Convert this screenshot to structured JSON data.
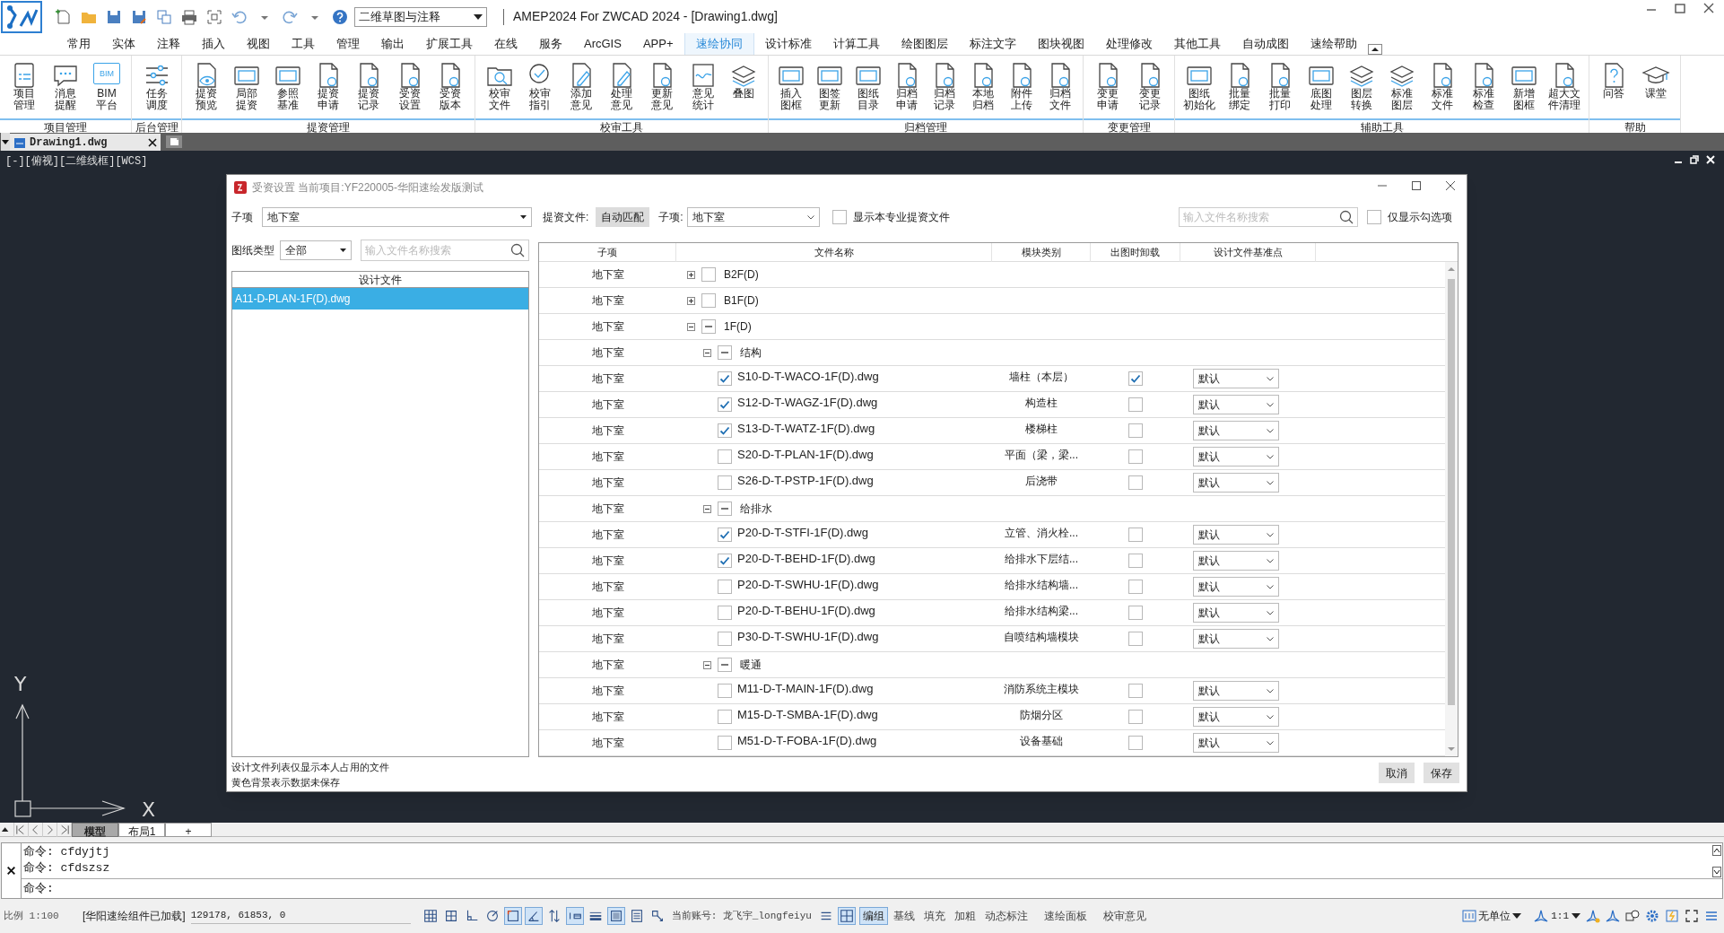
{
  "app": {
    "title": "AMEP2024 For ZWCAD 2024 - [Drawing1.dwg]",
    "workspace": "二维草图与注释"
  },
  "menu_tabs": [
    {
      "label": "常用",
      "selected": false
    },
    {
      "label": "实体",
      "selected": false
    },
    {
      "label": "注释",
      "selected": false
    },
    {
      "label": "插入",
      "selected": false
    },
    {
      "label": "视图",
      "selected": false
    },
    {
      "label": "工具",
      "selected": false
    },
    {
      "label": "管理",
      "selected": false
    },
    {
      "label": "输出",
      "selected": false
    },
    {
      "label": "扩展工具",
      "selected": false
    },
    {
      "label": "在线",
      "selected": false
    },
    {
      "label": "服务",
      "selected": false
    },
    {
      "label": "ArcGIS",
      "selected": false
    },
    {
      "label": "APP+",
      "selected": false
    },
    {
      "label": "速绘协同",
      "selected": true
    },
    {
      "label": "设计标准",
      "selected": false
    },
    {
      "label": "计算工具",
      "selected": false
    },
    {
      "label": "绘图图层",
      "selected": false
    },
    {
      "label": "标注文字",
      "selected": false
    },
    {
      "label": "图块视图",
      "selected": false
    },
    {
      "label": "处理修改",
      "selected": false
    },
    {
      "label": "其他工具",
      "selected": false
    },
    {
      "label": "自动成图",
      "selected": false
    },
    {
      "label": "速绘帮助",
      "selected": false
    }
  ],
  "ribbon_groups": [
    {
      "label": "项目管理",
      "buttons": [
        {
          "lines": [
            "项目",
            "管理"
          ]
        },
        {
          "lines": [
            "消息",
            "提醒"
          ]
        },
        {
          "lines": [
            "BIM",
            "平台"
          ],
          "badge": "BIM"
        }
      ]
    },
    {
      "label": "后台管理",
      "buttons": [
        {
          "lines": [
            "任务",
            "调度"
          ]
        }
      ]
    },
    {
      "label": "提资管理",
      "buttons": [
        {
          "lines": [
            "提资",
            "预览"
          ]
        },
        {
          "lines": [
            "局部",
            "提资"
          ]
        },
        {
          "lines": [
            "参照",
            "基准"
          ]
        },
        {
          "lines": [
            "提资",
            "申请"
          ]
        },
        {
          "lines": [
            "提资",
            "记录"
          ]
        },
        {
          "lines": [
            "受资",
            "设置"
          ]
        },
        {
          "lines": [
            "受资",
            "版本"
          ]
        }
      ]
    },
    {
      "label": "校审工具",
      "buttons": [
        {
          "lines": [
            "校审",
            "文件"
          ]
        },
        {
          "lines": [
            "校审",
            "指引"
          ]
        },
        {
          "lines": [
            "添加",
            "意见"
          ]
        },
        {
          "lines": [
            "处理",
            "意见"
          ]
        },
        {
          "lines": [
            "更新",
            "意见"
          ]
        },
        {
          "lines": [
            "意见",
            "统计"
          ]
        },
        {
          "lines": [
            "叠图"
          ]
        }
      ]
    },
    {
      "label": "归档管理",
      "buttons": [
        {
          "lines": [
            "插入",
            "图框"
          ]
        },
        {
          "lines": [
            "图签",
            "更新"
          ]
        },
        {
          "lines": [
            "图纸",
            "目录"
          ]
        },
        {
          "lines": [
            "归档",
            "申请"
          ]
        },
        {
          "lines": [
            "归档",
            "记录"
          ]
        },
        {
          "lines": [
            "本地",
            "归档"
          ]
        },
        {
          "lines": [
            "附件",
            "上传"
          ]
        },
        {
          "lines": [
            "归档",
            "文件"
          ]
        }
      ]
    },
    {
      "label": "变更管理",
      "buttons": [
        {
          "lines": [
            "变更",
            "申请"
          ]
        },
        {
          "lines": [
            "变更",
            "记录"
          ]
        }
      ]
    },
    {
      "label": "辅助工具",
      "buttons": [
        {
          "lines": [
            "图纸",
            "初始化"
          ]
        },
        {
          "lines": [
            "批量",
            "绑定"
          ]
        },
        {
          "lines": [
            "批量",
            "打印"
          ]
        },
        {
          "lines": [
            "底图",
            "处理"
          ]
        },
        {
          "lines": [
            "图层",
            "转换"
          ]
        },
        {
          "lines": [
            "标准",
            "图层"
          ]
        },
        {
          "lines": [
            "标准",
            "文件"
          ]
        },
        {
          "lines": [
            "标准",
            "检查"
          ]
        },
        {
          "lines": [
            "新增",
            "图框"
          ]
        },
        {
          "lines": [
            "超大文",
            "件清理"
          ]
        }
      ]
    },
    {
      "label": "帮助",
      "buttons": [
        {
          "lines": [
            "问答"
          ]
        },
        {
          "lines": [
            "课堂"
          ]
        }
      ]
    }
  ],
  "document_tabs": [
    {
      "label": "Drawing1.dwg",
      "selected": true
    }
  ],
  "viewport": {
    "label": "[-][俯视][二维线框][WCS]",
    "axis_y": "Y",
    "axis_x": "X"
  },
  "dialog": {
    "title": "受资设置 当前项目:YF220005-华阳速绘发版测试",
    "left": {
      "subitem_label": "子项",
      "subitem_value": "地下室",
      "type_label": "图纸类型",
      "type_value": "全部",
      "search_placeholder": "输入文件名称搜索",
      "list_header": "设计文件",
      "files": [
        {
          "name": "A11-D-PLAN-1F(D).dwg",
          "selected": true
        }
      ]
    },
    "right": {
      "files_label": "提资文件:",
      "auto_match": "自动匹配",
      "subitem_label": "子项:",
      "subitem_value": "地下室",
      "show_own": {
        "label": "显示本专业提资文件",
        "checked": false
      },
      "search_placeholder": "输入文件名称搜索",
      "only_checked": {
        "label": "仅显示勾选项",
        "checked": false
      },
      "columns": [
        "子项",
        "文件名称",
        "模块类别",
        "出图时卸载",
        "设计文件基准点"
      ],
      "rows": [
        {
          "kind": "folder",
          "subitem": "地下室",
          "name": "B2F(D)",
          "expanded": false,
          "checked": false,
          "indeterminate": false
        },
        {
          "kind": "folder",
          "subitem": "地下室",
          "name": "B1F(D)",
          "expanded": false,
          "checked": false,
          "indeterminate": false
        },
        {
          "kind": "folder",
          "subitem": "地下室",
          "name": "1F(D)",
          "expanded": true,
          "checked": false,
          "indeterminate": true,
          "children": [
            {
              "kind": "folder",
              "subitem": "地下室",
              "name": "结构",
              "expanded": true,
              "checked": false,
              "indeterminate": true,
              "children": [
                {
                  "kind": "file",
                  "subitem": "地下室",
                  "name": "S10-D-T-WACO-1F(D).dwg",
                  "checked": true,
                  "module": "墙柱（本层）",
                  "unload": true,
                  "basepoint": "默认"
                },
                {
                  "kind": "file",
                  "subitem": "地下室",
                  "name": "S12-D-T-WAGZ-1F(D).dwg",
                  "checked": true,
                  "module": "构造柱",
                  "unload": false,
                  "basepoint": "默认"
                },
                {
                  "kind": "file",
                  "subitem": "地下室",
                  "name": "S13-D-T-WATZ-1F(D).dwg",
                  "checked": true,
                  "module": "楼梯柱",
                  "unload": false,
                  "basepoint": "默认"
                },
                {
                  "kind": "file",
                  "subitem": "地下室",
                  "name": "S20-D-T-PLAN-1F(D).dwg",
                  "checked": false,
                  "module": "平面（梁，梁...",
                  "unload": false,
                  "basepoint": "默认"
                },
                {
                  "kind": "file",
                  "subitem": "地下室",
                  "name": "S26-D-T-PSTP-1F(D).dwg",
                  "checked": false,
                  "module": "后浇带",
                  "unload": false,
                  "basepoint": "默认"
                }
              ]
            },
            {
              "kind": "folder",
              "subitem": "地下室",
              "name": "给排水",
              "expanded": true,
              "checked": false,
              "indeterminate": true,
              "children": [
                {
                  "kind": "file",
                  "subitem": "地下室",
                  "name": "P20-D-T-STFI-1F(D).dwg",
                  "checked": true,
                  "module": "立管、消火栓...",
                  "unload": false,
                  "basepoint": "默认"
                },
                {
                  "kind": "file",
                  "subitem": "地下室",
                  "name": "P20-D-T-BEHD-1F(D).dwg",
                  "checked": true,
                  "module": "给排水下层结...",
                  "unload": false,
                  "basepoint": "默认"
                },
                {
                  "kind": "file",
                  "subitem": "地下室",
                  "name": "P20-D-T-SWHU-1F(D).dwg",
                  "checked": false,
                  "module": "给排水结构墙...",
                  "unload": false,
                  "basepoint": "默认"
                },
                {
                  "kind": "file",
                  "subitem": "地下室",
                  "name": "P20-D-T-BEHU-1F(D).dwg",
                  "checked": false,
                  "module": "给排水结构梁...",
                  "unload": false,
                  "basepoint": "默认"
                },
                {
                  "kind": "file",
                  "subitem": "地下室",
                  "name": "P30-D-T-SWHU-1F(D).dwg",
                  "checked": false,
                  "module": "自喷结构墙模块",
                  "unload": false,
                  "basepoint": "默认"
                }
              ]
            },
            {
              "kind": "folder",
              "subitem": "地下室",
              "name": "暖通",
              "expanded": true,
              "checked": false,
              "indeterminate": true,
              "children": [
                {
                  "kind": "file",
                  "subitem": "地下室",
                  "name": "M11-D-T-MAIN-1F(D).dwg",
                  "checked": false,
                  "module": "消防系统主模块",
                  "unload": false,
                  "basepoint": "默认"
                },
                {
                  "kind": "file",
                  "subitem": "地下室",
                  "name": "M15-D-T-SMBA-1F(D).dwg",
                  "checked": false,
                  "module": "防烟分区",
                  "unload": false,
                  "basepoint": "默认"
                },
                {
                  "kind": "file",
                  "subitem": "地下室",
                  "name": "M51-D-T-FOBA-1F(D).dwg",
                  "checked": false,
                  "module": "设备基础",
                  "unload": false,
                  "basepoint": "默认"
                }
              ]
            }
          ]
        }
      ]
    },
    "notes": [
      "设计文件列表仅显示本人占用的文件",
      "黄色背景表示数据未保存"
    ],
    "buttons": [
      "取消",
      "保存"
    ]
  },
  "layout_tabs": [
    {
      "label": "模型",
      "selected": true
    },
    {
      "label": "布局1",
      "selected": false
    },
    {
      "label": "+",
      "selected": false
    }
  ],
  "command_line": {
    "history": [
      "命令: cfdyjtj",
      "命令: cfdszsz"
    ],
    "prompt": "命令:"
  },
  "status_bar": {
    "scale": "比例 1:100",
    "plugin": "[华阳速绘组件已加载]",
    "coords": "129178, 61853, 0",
    "toggles": [
      {
        "on": false
      },
      {
        "on": false
      },
      {
        "on": false
      },
      {
        "on": false
      },
      {
        "on": true
      },
      {
        "on": true
      },
      {
        "on": false
      },
      {
        "on": true
      },
      {
        "on": false
      },
      {
        "on": true
      },
      {
        "on": false
      },
      {
        "on": false
      }
    ],
    "account": "当前账号: 龙飞宇_longfeiyu",
    "toggles_2": [
      {
        "on": false
      },
      {
        "on": true
      }
    ],
    "text_toggles": [
      {
        "label": "编组",
        "on": true
      },
      {
        "label": "基线",
        "on": false
      },
      {
        "label": "填充",
        "on": false
      },
      {
        "label": "加粗",
        "on": false
      },
      {
        "label": "动态标注",
        "on": false
      },
      {
        "label": "速绘面板",
        "on": false
      },
      {
        "label": "校审意见",
        "on": false
      }
    ],
    "units": "无单位",
    "annotation_scale": "1:1"
  }
}
